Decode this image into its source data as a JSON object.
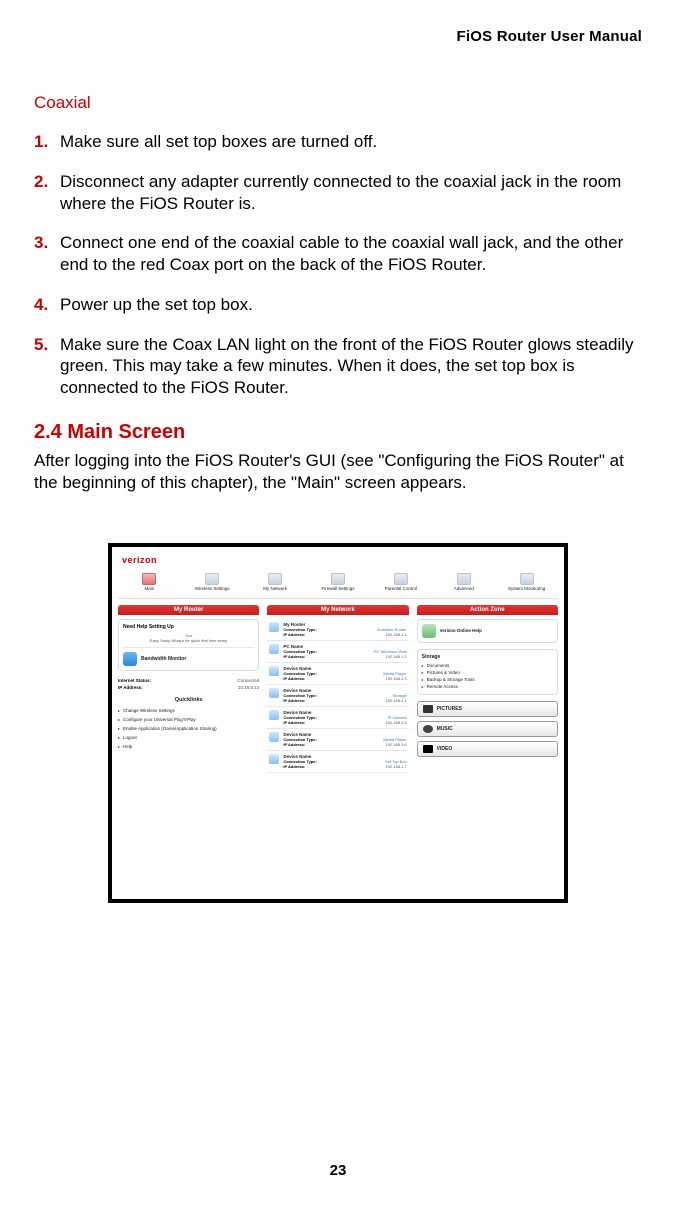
{
  "header": {
    "manual_title": "FiOS Router User Manual"
  },
  "coaxial": {
    "heading": "Coaxial",
    "steps": [
      "Make sure all set top boxes are turned off.",
      "Disconnect any adapter currently connected to the coaxial jack in the room where the FiOS Router is.",
      "Connect one end of the coaxial cable to the coaxial wall jack, and the other end to the red Coax port on the back of the FiOS Router.",
      "Power up the set top box.",
      "Make sure the Coax LAN light on the front of the FiOS Router glows steadily green. This may take a few minutes. When it does, the set top box is connected to the FiOS Router."
    ]
  },
  "section": {
    "heading": "2.4  Main Screen",
    "body": "After logging into the FiOS Router's GUI (see \"Configuring the FiOS Router\" at the beginning of this chapter), the \"Main\" screen appears."
  },
  "page_number": "23",
  "screenshot": {
    "brand": "verizon",
    "tabs": [
      "Main",
      "Wireless Settings",
      "My Network",
      "Firewall Settings",
      "Parental Control",
      "Advanced",
      "System Monitoring"
    ],
    "columns": {
      "router": {
        "title": "My Router",
        "card_title": "Need Help Setting Up",
        "card_sub_1": "Our",
        "card_sub_2": "Easy Setup Wizard for quick first time setup",
        "bandwidth_label": "Bandwidth Monitor",
        "status": [
          {
            "k": "Internet Status:",
            "v": "Connected"
          },
          {
            "k": "IP Address:",
            "v": "10.16.0.12"
          }
        ],
        "quicklinks_title": "Quicklinks",
        "quicklinks": [
          "Change Wireless Settings",
          "Configure your Universal Plug'n'Play",
          "Enable Application (Game/Application Sharing)",
          "Logout",
          "Help"
        ]
      },
      "network": {
        "title": "My Network",
        "devices": [
          {
            "name": "My Router",
            "type": "Actiontec Router",
            "ip": "192.168.1.1"
          },
          {
            "name": "PC Name",
            "type": "PC Windows Vista",
            "ip": "192.168.1.2"
          },
          {
            "name": "Device Name",
            "type": "Media Player",
            "ip": "192.168.1.3"
          },
          {
            "name": "Device Name",
            "type": "Storage",
            "ip": "192.168.1.4"
          },
          {
            "name": "Device Name",
            "type": "IP Camera",
            "ip": "192.168.1.5"
          },
          {
            "name": "Device Name",
            "type": "Media Player",
            "ip": "192.168.1.6"
          },
          {
            "name": "Device Name",
            "type": "Set Top Box",
            "ip": "192.168.1.7"
          }
        ]
      },
      "action": {
        "title": "Action Zone",
        "badge": "Verizon Online Help",
        "storage_title": "Storage",
        "storage_items": [
          "Documents",
          "Pictures & Video",
          "Backup & Storage Tools",
          "Remote Access"
        ],
        "buttons": {
          "pictures": "PICTURES",
          "music": "MUSIC",
          "video": "VIDEO"
        }
      }
    }
  }
}
